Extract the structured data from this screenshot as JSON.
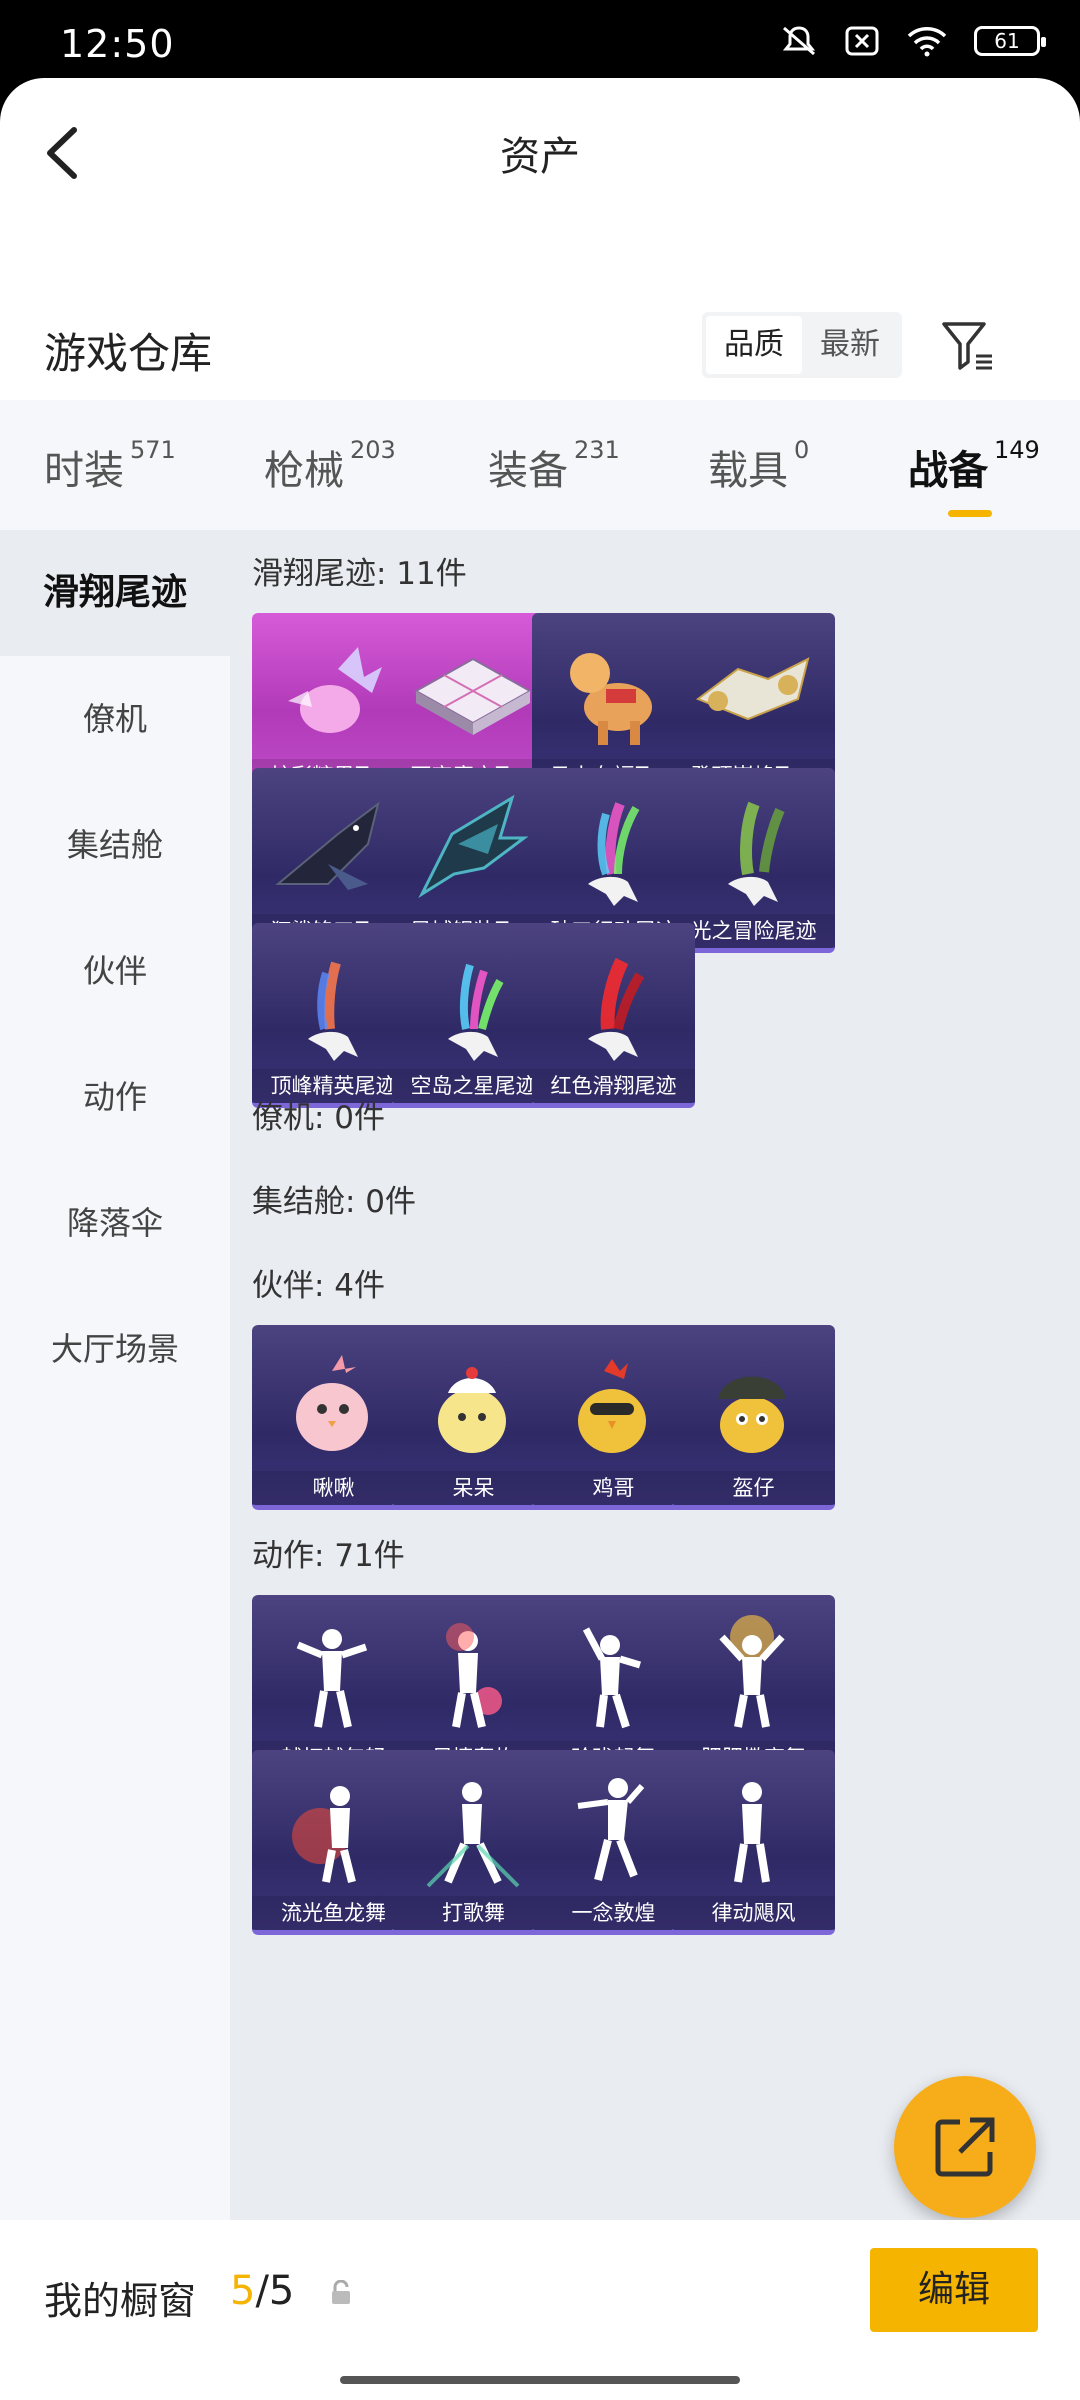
{
  "status": {
    "time": "12:50",
    "battery": "61"
  },
  "header": {
    "title": "资产"
  },
  "section": {
    "title": "游戏仓库",
    "sort_quality": "品质",
    "sort_newest": "最新"
  },
  "tabs": [
    {
      "label": "时装",
      "count": "571"
    },
    {
      "label": "枪械",
      "count": "203"
    },
    {
      "label": "装备",
      "count": "231"
    },
    {
      "label": "载具",
      "count": "0"
    },
    {
      "label": "战备",
      "count": "149"
    }
  ],
  "sidebar": [
    "滑翔尾迹",
    "僚机",
    "集结舱",
    "伙伴",
    "动作",
    "降落伞",
    "大厅场景"
  ],
  "groups": {
    "trail": {
      "title": "滑翔尾迹: 11件",
      "items": [
        "炫彩糖果飞…",
        "百变魔方飞…",
        "马上有福飞…",
        "登顶巅峰飞…",
        "狂鲨锋刃飞…",
        "异域银装飞…",
        "破刃行动尾迹",
        "光之冒险尾迹",
        "顶峰精英尾迹",
        "空岛之星尾迹",
        "红色滑翔尾迹"
      ]
    },
    "wingman": {
      "title": "僚机: 0件"
    },
    "capsule": {
      "title": "集结舱: 0件"
    },
    "partner": {
      "title": "伙伴: 4件",
      "items": [
        "啾啾",
        "呆呆",
        "鸡哥",
        "盔仔"
      ]
    },
    "action": {
      "title": "动作: 71件",
      "items": [
        "越打越年轻",
        "尽情轰炸",
        "玲珑起舞",
        "肥肥撒离舞",
        "流光鱼龙舞",
        "打歌舞",
        "一念敦煌",
        "律动飓风"
      ]
    }
  },
  "bottom": {
    "label": "我的橱窗",
    "current": "5",
    "sep_total": "/5",
    "edit": "编辑"
  },
  "colors": {
    "accent": "#f5b400",
    "card_purple": "#3a3378",
    "card_pink": "#c04dc9"
  }
}
